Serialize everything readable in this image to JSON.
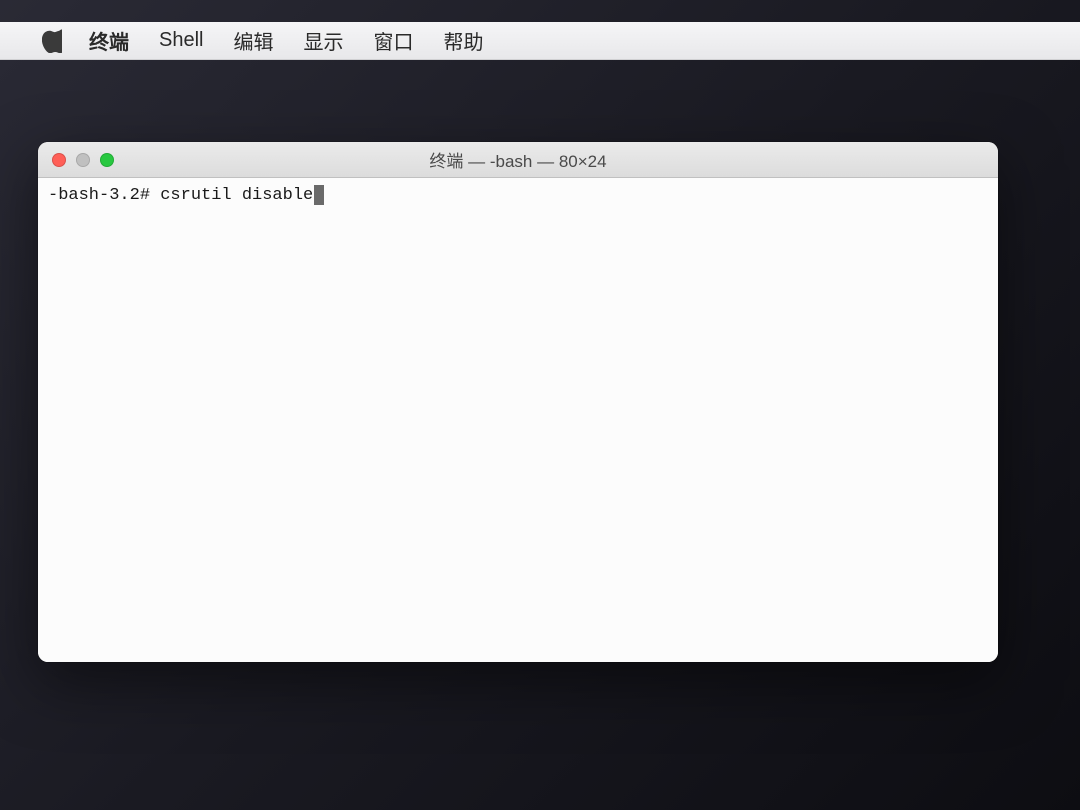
{
  "menubar": {
    "app_name": "终端",
    "items": [
      "Shell",
      "编辑",
      "显示",
      "窗口",
      "帮助"
    ]
  },
  "window": {
    "title": "终端 — -bash — 80×24",
    "traffic_lights": {
      "close": "close-icon",
      "minimize": "minimize-icon",
      "maximize": "maximize-icon"
    }
  },
  "terminal": {
    "prompt": "-bash-3.2# ",
    "command": "csrutil disable"
  }
}
